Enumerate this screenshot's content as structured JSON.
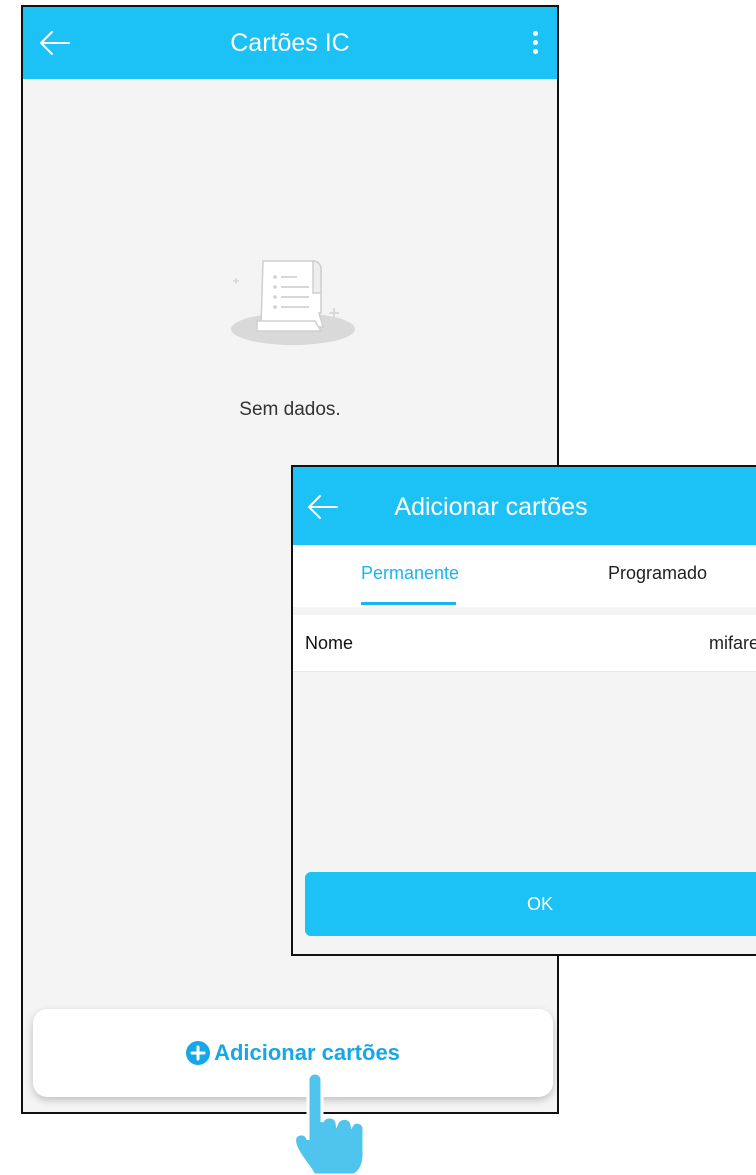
{
  "screen1": {
    "title": "Cartões IC",
    "empty_text": "Sem dados.",
    "add_button_label": "Adicionar cartões",
    "back_icon": "arrow-left-icon",
    "menu_icon": "more-vertical-icon"
  },
  "screen2": {
    "title": "Adicionar cartões",
    "tabs": [
      {
        "label": "Permanente",
        "active": true
      },
      {
        "label": "Programado",
        "active": false
      }
    ],
    "form": {
      "name_label": "Nome",
      "name_value": "mifare"
    },
    "ok_label": "OK"
  },
  "colors": {
    "accent": "#1cc1f5",
    "accent_text": "#16a8e6",
    "background": "#f4f4f4"
  }
}
